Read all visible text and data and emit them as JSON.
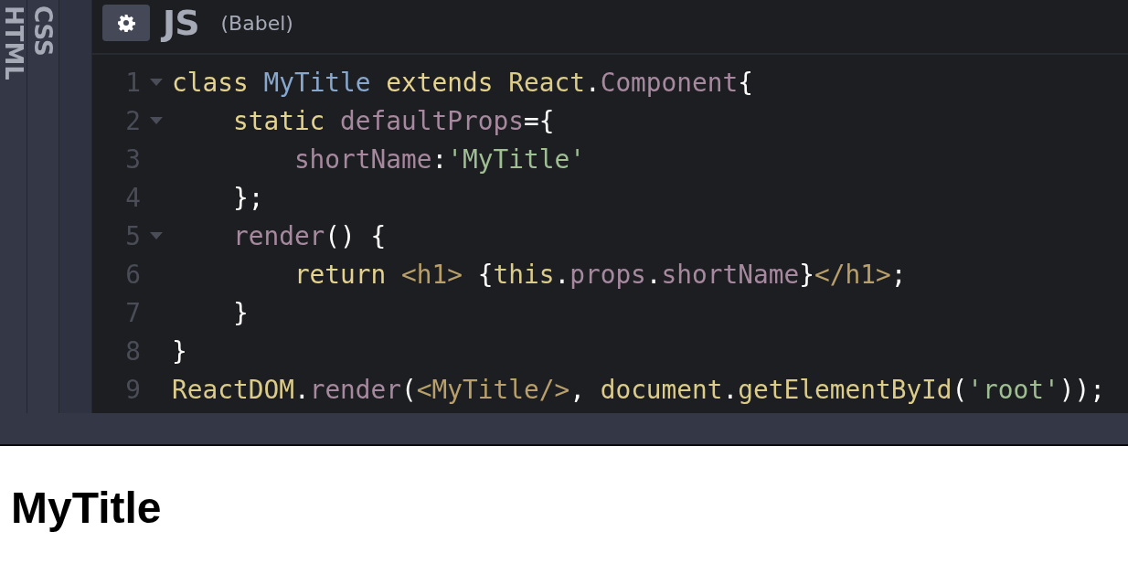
{
  "side_tabs": [
    {
      "label": "HTML"
    },
    {
      "label": "CSS"
    }
  ],
  "editor": {
    "title": "JS",
    "subtitle": "(Babel)",
    "lines": [
      {
        "number": "1",
        "fold": true,
        "tokens": [
          {
            "kind": "keyword",
            "text": "class "
          },
          {
            "kind": "classname",
            "text": "MyTitle"
          },
          {
            "kind": "keyword",
            "text": " extends "
          },
          {
            "kind": "variable",
            "text": "React"
          },
          {
            "kind": "punct",
            "text": "."
          },
          {
            "kind": "property",
            "text": "Component"
          },
          {
            "kind": "punct",
            "text": "{"
          }
        ]
      },
      {
        "number": "2",
        "fold": true,
        "tokens": [
          {
            "kind": "keyword",
            "text": "    static "
          },
          {
            "kind": "property",
            "text": "defaultProps"
          },
          {
            "kind": "punct",
            "text": "={"
          }
        ]
      },
      {
        "number": "3",
        "fold": false,
        "tokens": [
          {
            "kind": "property",
            "text": "        shortName"
          },
          {
            "kind": "punct",
            "text": ":"
          },
          {
            "kind": "string",
            "text": "'MyTitle'"
          }
        ]
      },
      {
        "number": "4",
        "fold": false,
        "tokens": [
          {
            "kind": "punct",
            "text": "    };"
          }
        ]
      },
      {
        "number": "5",
        "fold": true,
        "tokens": [
          {
            "kind": "property",
            "text": "    render"
          },
          {
            "kind": "punct",
            "text": "() {"
          }
        ]
      },
      {
        "number": "6",
        "fold": false,
        "tokens": [
          {
            "kind": "keyword",
            "text": "        return "
          },
          {
            "kind": "tag",
            "text": "<h1>"
          },
          {
            "kind": "punct",
            "text": " {"
          },
          {
            "kind": "variable",
            "text": "this"
          },
          {
            "kind": "punct",
            "text": "."
          },
          {
            "kind": "property",
            "text": "props"
          },
          {
            "kind": "punct",
            "text": "."
          },
          {
            "kind": "property",
            "text": "shortName"
          },
          {
            "kind": "punct",
            "text": "}"
          },
          {
            "kind": "tag",
            "text": "</h1>"
          },
          {
            "kind": "punct",
            "text": ";"
          }
        ]
      },
      {
        "number": "7",
        "fold": false,
        "tokens": [
          {
            "kind": "punct",
            "text": "    }"
          }
        ]
      },
      {
        "number": "8",
        "fold": false,
        "tokens": [
          {
            "kind": "punct",
            "text": "}"
          }
        ]
      },
      {
        "number": "9",
        "fold": false,
        "tokens": [
          {
            "kind": "variable",
            "text": "ReactDOM"
          },
          {
            "kind": "punct",
            "text": "."
          },
          {
            "kind": "property",
            "text": "render"
          },
          {
            "kind": "punct",
            "text": "("
          },
          {
            "kind": "tag",
            "text": "<MyTitle/>"
          },
          {
            "kind": "punct",
            "text": ", "
          },
          {
            "kind": "variable",
            "text": "document"
          },
          {
            "kind": "punct",
            "text": "."
          },
          {
            "kind": "variable",
            "text": "getElementById"
          },
          {
            "kind": "punct",
            "text": "("
          },
          {
            "kind": "string",
            "text": "'root'"
          },
          {
            "kind": "punct",
            "text": "));"
          }
        ]
      }
    ]
  },
  "preview": {
    "heading": "MyTitle"
  }
}
